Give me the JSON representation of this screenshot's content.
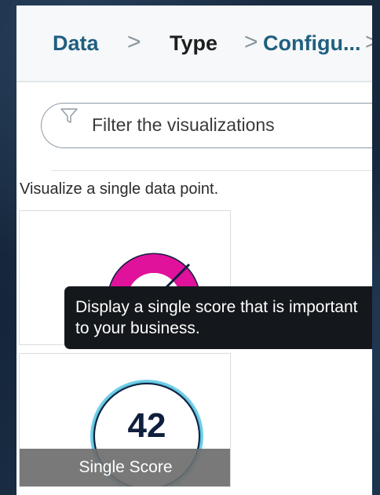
{
  "breadcrumb": {
    "steps": [
      "Data",
      "Type",
      "Configu..."
    ],
    "separator": ">"
  },
  "filter": {
    "placeholder": "Filter the visualizations",
    "icon": "filter-funnel-icon"
  },
  "section": {
    "description": "Visualize a single data point."
  },
  "cards": [
    {
      "thumbnail": "gauge-icon",
      "label": ""
    },
    {
      "thumbnail": "single-score-icon",
      "value": "42",
      "label": "Single Score"
    }
  ],
  "tooltip": {
    "text": "Display a single score that is important to your business."
  },
  "colors": {
    "link": "#1f5f80",
    "active": "#1e1e1e",
    "gauge": "#e0119b",
    "score_ring": "#57c7e4",
    "tooltip_bg": "#14171b"
  }
}
